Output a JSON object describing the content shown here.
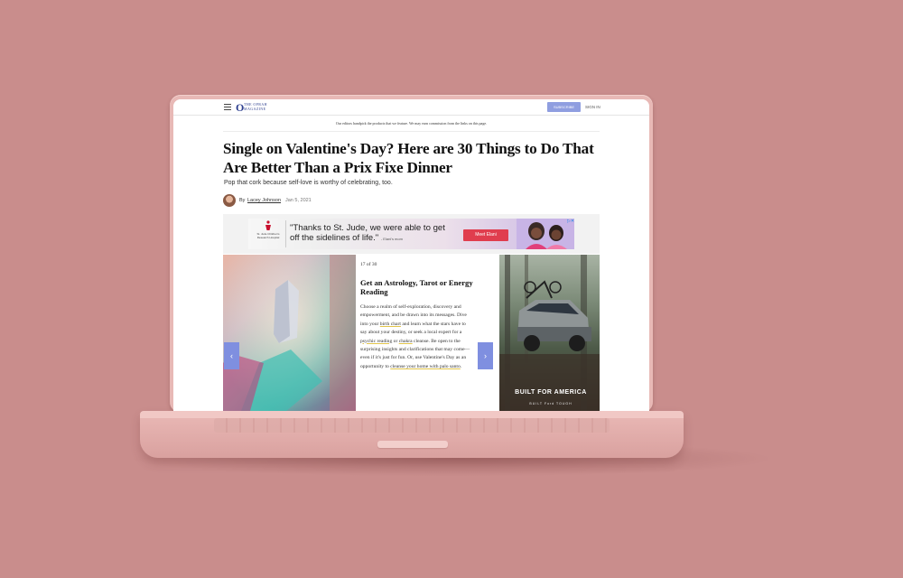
{
  "header": {
    "logo_letter": "O",
    "logo_text": "THE OPRAH MAGAZINE",
    "subscribe_label": "SUBSCRIBE",
    "signin_label": "SIGN IN"
  },
  "disclaimer": "Our editors handpick the products that we feature. We may earn commission from the links on this page.",
  "article": {
    "headline": "Single on Valentine's Day? Here are 30 Things to Do That Are Better Than a Prix Fixe Dinner",
    "dek": "Pop that cork because self-love is worthy of celebrating, too.",
    "by_label": "By",
    "author": "Lacey Johnson",
    "date": "Jan 5, 2021"
  },
  "top_ad": {
    "logo_text": "St. Jude Children's Research Hospital",
    "quote": "\"Thanks to St. Jude, we were able to get off the sidelines of life.\"",
    "attribution": "- Elani's mom",
    "cta_label": "Meet Elani",
    "close_label": "▷✕"
  },
  "slideshow": {
    "counter": "17 of 30",
    "title": "Get an Astrology, Tarot or Energy Reading",
    "body_1": "Choose a realm of self-exploration, discovery and empowerment, and be drawn into its messages. Dive into your ",
    "link_birth_chart": "birth chart",
    "body_2": " and learn what the stars have to say about your destiny, or seek a local expert for a ",
    "link_psychic": "psychic reading",
    "body_3": " or ",
    "link_chakra": "chakra",
    "body_4": " cleanse. Be open to the surprising insights and clarifications that may come—even if it's just for fun. Or, use Valentine's Day as an opportunity to ",
    "link_cleanse": "cleanse your home with palo santo",
    "body_5": ".",
    "prev_icon": "‹",
    "next_icon": "›"
  },
  "side_ad": {
    "caption": "BUILT FOR AMERICA",
    "tagline": "BUILT Ford TOUGH"
  }
}
